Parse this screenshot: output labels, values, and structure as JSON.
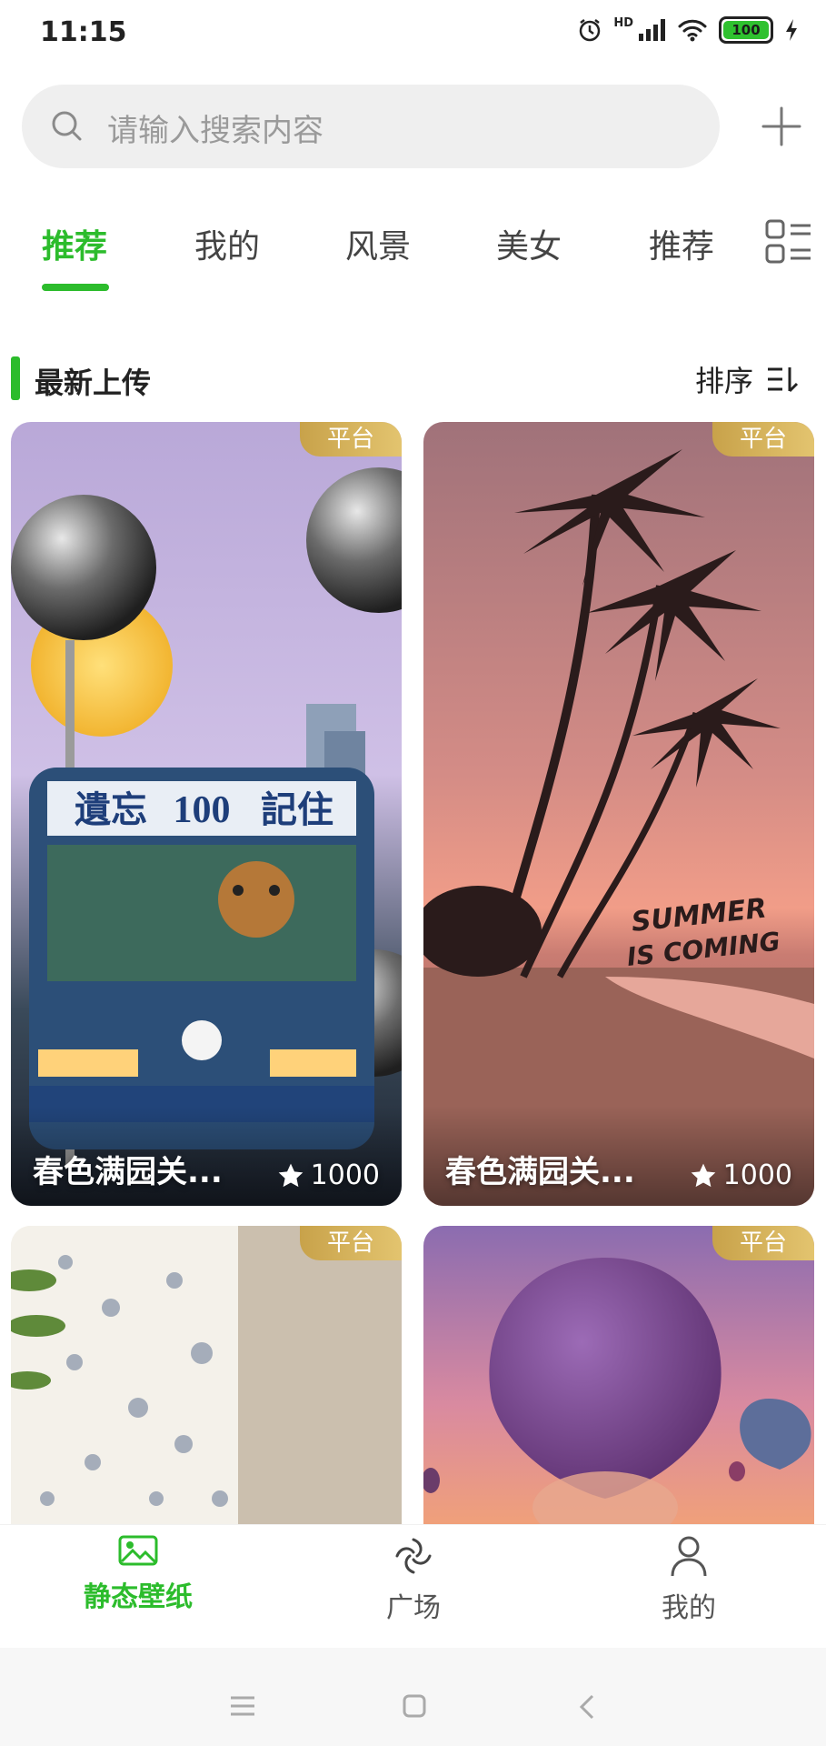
{
  "status_bar": {
    "time": "11:15",
    "battery": "100",
    "network": "HD"
  },
  "search": {
    "placeholder": "请输入搜索内容"
  },
  "tabs": [
    {
      "label": "推荐",
      "active": true
    },
    {
      "label": "我的"
    },
    {
      "label": "风景"
    },
    {
      "label": "美女"
    },
    {
      "label": "推荐"
    }
  ],
  "section": {
    "title": "最新上传",
    "sort_label": "排序"
  },
  "cards": [
    {
      "badge": "平台",
      "title": "春色满园关...",
      "likes": "1000"
    },
    {
      "badge": "平台",
      "title": "春色满园关...",
      "likes": "1000"
    },
    {
      "badge": "平台"
    },
    {
      "badge": "平台"
    }
  ],
  "bottom_nav": [
    {
      "label": "静态壁纸",
      "icon": "image-icon",
      "active": true
    },
    {
      "label": "广场",
      "icon": "plaza-icon"
    },
    {
      "label": "我的",
      "icon": "user-icon"
    }
  ],
  "colors": {
    "accent": "#2cbc2c",
    "badge": "#d4b25c"
  }
}
